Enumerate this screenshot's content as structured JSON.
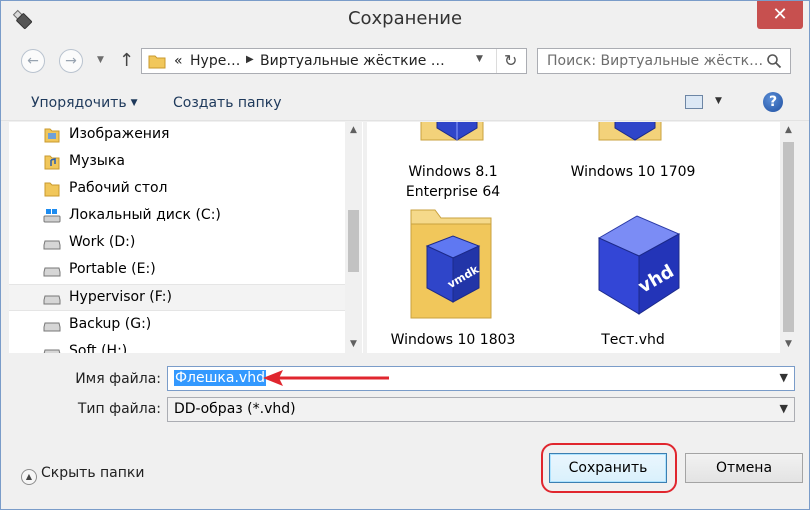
{
  "window": {
    "title": "Сохранение",
    "close_label": "✕"
  },
  "nav": {
    "breadcrumb_lead": "«",
    "breadcrumb": [
      "Hype…",
      "Виртуальные жёсткие …"
    ],
    "search_placeholder": "Поиск: Виртуальные жёстк…"
  },
  "toolbar": {
    "organize": "Упорядочить",
    "new_folder": "Создать папку",
    "help": "?"
  },
  "sidebar": {
    "items": [
      {
        "label": "Изображения",
        "icon": "pictures-folder-icon"
      },
      {
        "label": "Музыка",
        "icon": "music-folder-icon"
      },
      {
        "label": "Рабочий стол",
        "icon": "desktop-folder-icon"
      },
      {
        "label": "Локальный диск (C:)",
        "icon": "system-drive-icon"
      },
      {
        "label": "Work (D:)",
        "icon": "drive-icon"
      },
      {
        "label": "Portable (E:)",
        "icon": "drive-icon"
      },
      {
        "label": "Hypervisor (F:)",
        "icon": "drive-icon",
        "selected": true
      },
      {
        "label": "Backup (G:)",
        "icon": "drive-icon"
      },
      {
        "label": "Soft (H:)",
        "icon": "drive-icon"
      }
    ]
  },
  "files": [
    {
      "label": "Windows 8.1\nEnterprise 64",
      "icon": "vmdk-folder-icon"
    },
    {
      "label": "Windows 10 1709",
      "icon": "vmdk-folder-icon"
    },
    {
      "label": "Windows 10 1803",
      "icon": "vmdk-folder-icon",
      "badge": "vmdk"
    },
    {
      "label": "Тест.vhd",
      "icon": "vhd-file-icon",
      "badge": "vhd"
    }
  ],
  "form": {
    "filename_label": "Имя файла:",
    "filename_value": "Флешка.vhd",
    "filetype_label": "Тип файла:",
    "filetype_value": "DD-образ (*.vhd)"
  },
  "footer": {
    "hide_folders": "Скрыть папки",
    "save": "Сохранить",
    "cancel": "Отмена"
  },
  "colors": {
    "accent": "#3399ff",
    "annotation": "#e0262e",
    "close": "#c7504f"
  }
}
